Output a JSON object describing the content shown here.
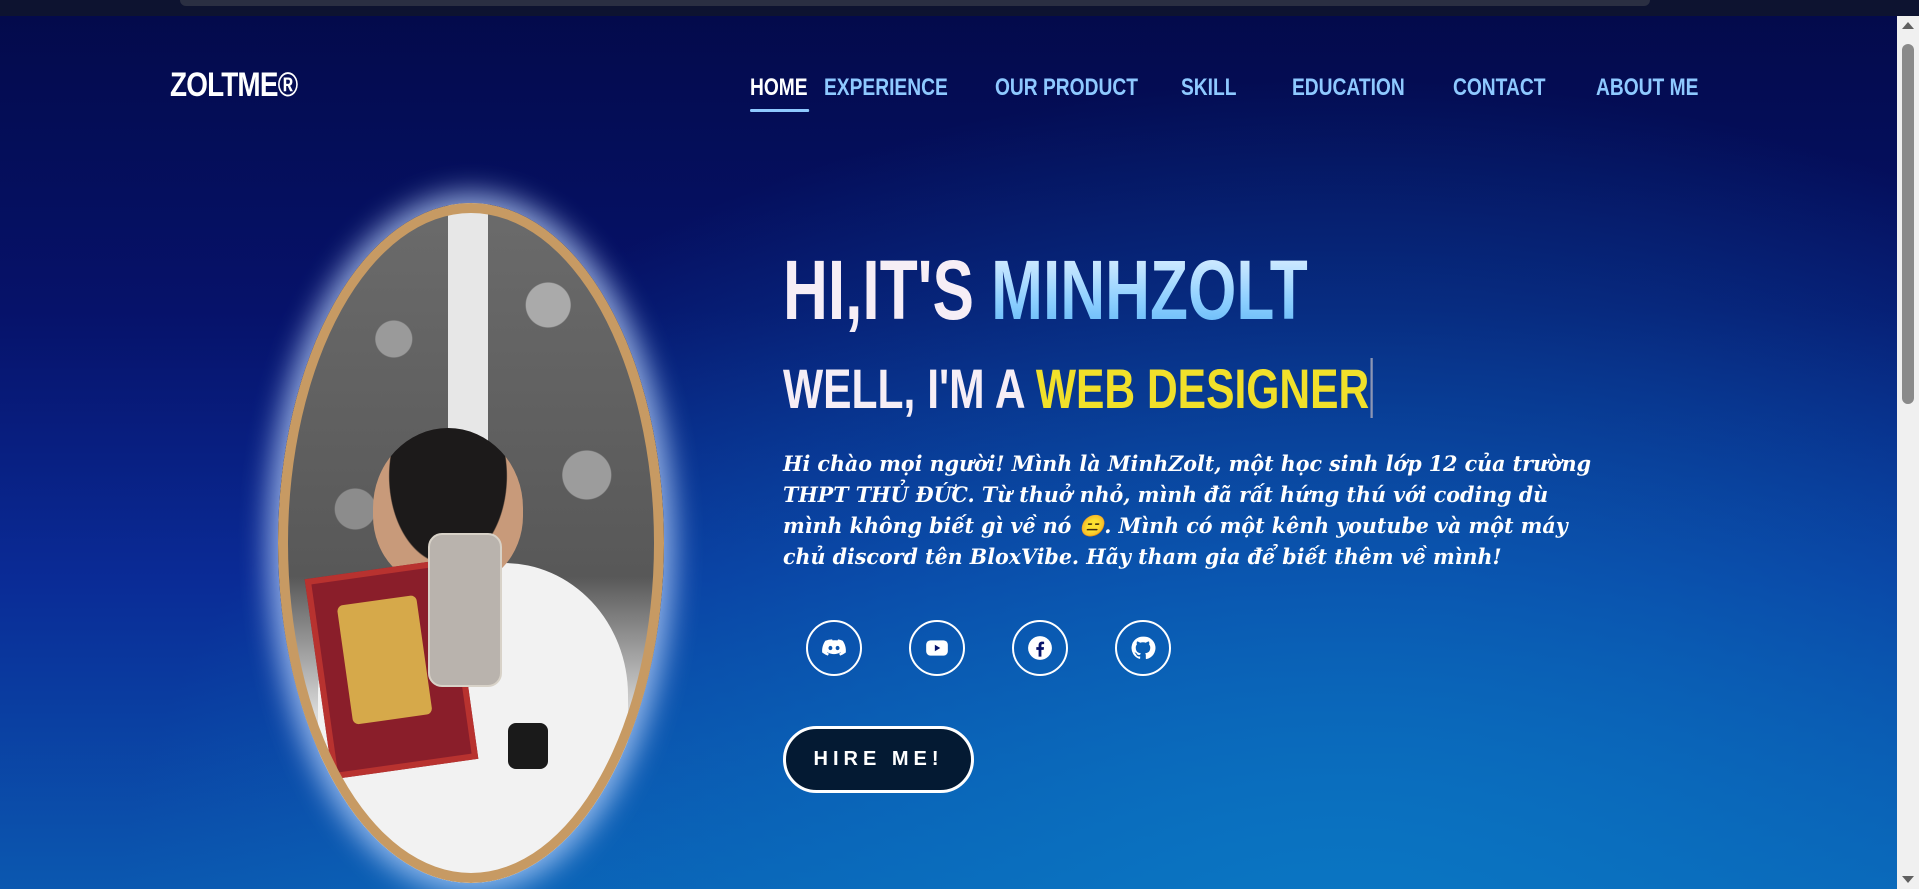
{
  "header": {
    "logo": "ZOLTME®",
    "nav": [
      {
        "label": "HOME",
        "active": true
      },
      {
        "label": "EXPERIENCE",
        "active": false
      },
      {
        "label": "OUR PRODUCT",
        "active": false
      },
      {
        "label": "SKILL",
        "active": false
      },
      {
        "label": "EDUCATION",
        "active": false
      },
      {
        "label": "CONTACT",
        "active": false
      },
      {
        "label": "ABOUT ME",
        "active": false
      }
    ]
  },
  "hero": {
    "greeting": "HI,IT'S ",
    "name": "MINHZOLT",
    "subtitle_prefix": "WELL, I'M A ",
    "role": "WEB DESIGNER",
    "bio": "Hi chào mọi người! Mình là MinhZolt, một học sinh lớp 12 của trường THPT THỦ ĐỨC. Từ thuở nhỏ, mình đã rất hứng thú với coding dù mình không biết gì về nó 😑. Mình có một kênh youtube và một máy chủ discord tên BloxVibe. Hãy tham gia để biết thêm về mình!",
    "hire_button": "HIRE ME!"
  },
  "social": [
    {
      "icon": "discord-icon"
    },
    {
      "icon": "youtube-icon"
    },
    {
      "icon": "facebook-icon"
    },
    {
      "icon": "github-icon"
    }
  ],
  "colors": {
    "background_top": "#030a4a",
    "background_bottom": "#0b58b0",
    "nav_inactive": "#8ec9ff",
    "accent_yellow": "#f1e02a",
    "hire_button_bg": "#041a33"
  }
}
